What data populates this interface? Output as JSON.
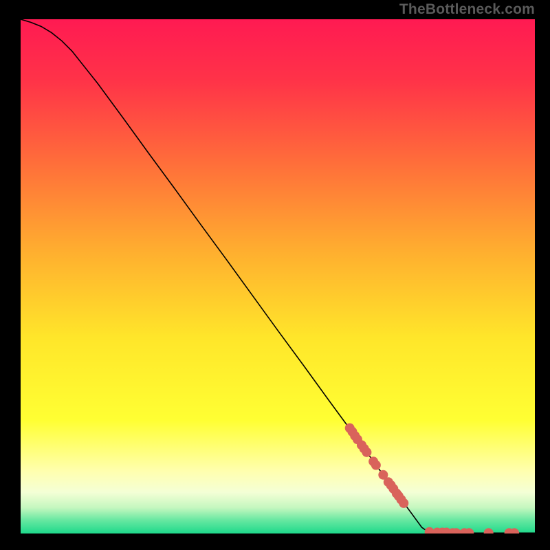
{
  "attribution": "TheBottleneck.com",
  "chart_data": {
    "type": "line",
    "title": "",
    "xlabel": "",
    "ylabel": "",
    "xlim": [
      0,
      100
    ],
    "ylim": [
      0,
      100
    ],
    "grid": false,
    "legend": false,
    "curve": {
      "name": "bottleneck-curve",
      "color": "#000000",
      "points": [
        {
          "x": 0,
          "y": 100.0
        },
        {
          "x": 2,
          "y": 99.4
        },
        {
          "x": 4,
          "y": 98.6
        },
        {
          "x": 6,
          "y": 97.4
        },
        {
          "x": 8,
          "y": 95.8
        },
        {
          "x": 10,
          "y": 93.8
        },
        {
          "x": 15,
          "y": 87.5
        },
        {
          "x": 20,
          "y": 80.7
        },
        {
          "x": 25,
          "y": 73.8
        },
        {
          "x": 30,
          "y": 67.0
        },
        {
          "x": 35,
          "y": 60.1
        },
        {
          "x": 40,
          "y": 53.3
        },
        {
          "x": 45,
          "y": 46.4
        },
        {
          "x": 50,
          "y": 39.5
        },
        {
          "x": 55,
          "y": 32.7
        },
        {
          "x": 60,
          "y": 25.8
        },
        {
          "x": 65,
          "y": 19.0
        },
        {
          "x": 70,
          "y": 12.1
        },
        {
          "x": 75,
          "y": 5.3
        },
        {
          "x": 78,
          "y": 1.2
        },
        {
          "x": 79,
          "y": 0.5
        },
        {
          "x": 80,
          "y": 0.2
        },
        {
          "x": 85,
          "y": 0.1
        },
        {
          "x": 90,
          "y": 0.1
        },
        {
          "x": 95,
          "y": 0.1
        },
        {
          "x": 100,
          "y": 0.1
        }
      ]
    },
    "markers": {
      "name": "highlighted-points",
      "color": "#d9635b",
      "radius_px": 7,
      "points": [
        {
          "x": 64.0,
          "y": 20.5
        },
        {
          "x": 64.5,
          "y": 19.8
        },
        {
          "x": 65.0,
          "y": 19.0
        },
        {
          "x": 65.5,
          "y": 18.3
        },
        {
          "x": 66.3,
          "y": 17.2
        },
        {
          "x": 66.8,
          "y": 16.5
        },
        {
          "x": 67.3,
          "y": 15.8
        },
        {
          "x": 68.6,
          "y": 14.0
        },
        {
          "x": 69.1,
          "y": 13.3
        },
        {
          "x": 70.5,
          "y": 11.4
        },
        {
          "x": 71.5,
          "y": 10.0
        },
        {
          "x": 72.0,
          "y": 9.4
        },
        {
          "x": 72.5,
          "y": 8.7
        },
        {
          "x": 73.1,
          "y": 7.8
        },
        {
          "x": 73.5,
          "y": 7.3
        },
        {
          "x": 74.0,
          "y": 6.6
        },
        {
          "x": 74.5,
          "y": 5.9
        },
        {
          "x": 79.5,
          "y": 0.3
        },
        {
          "x": 81.0,
          "y": 0.2
        },
        {
          "x": 82.0,
          "y": 0.2
        },
        {
          "x": 82.8,
          "y": 0.2
        },
        {
          "x": 84.0,
          "y": 0.1
        },
        {
          "x": 84.7,
          "y": 0.1
        },
        {
          "x": 86.3,
          "y": 0.1
        },
        {
          "x": 87.2,
          "y": 0.1
        },
        {
          "x": 91.0,
          "y": 0.1
        },
        {
          "x": 95.0,
          "y": 0.1
        },
        {
          "x": 96.0,
          "y": 0.1
        }
      ]
    },
    "background": {
      "type": "vertical-gradient",
      "stops": [
        {
          "pos": 0.0,
          "color": "#ff1a52"
        },
        {
          "pos": 0.12,
          "color": "#ff3348"
        },
        {
          "pos": 0.28,
          "color": "#ff6e3a"
        },
        {
          "pos": 0.45,
          "color": "#ffae2f"
        },
        {
          "pos": 0.62,
          "color": "#ffe62a"
        },
        {
          "pos": 0.78,
          "color": "#ffff33"
        },
        {
          "pos": 0.88,
          "color": "#ffffb0"
        },
        {
          "pos": 0.92,
          "color": "#f4ffd6"
        },
        {
          "pos": 0.95,
          "color": "#c4f7bf"
        },
        {
          "pos": 0.975,
          "color": "#64e7a0"
        },
        {
          "pos": 1.0,
          "color": "#1ed98b"
        }
      ]
    }
  }
}
